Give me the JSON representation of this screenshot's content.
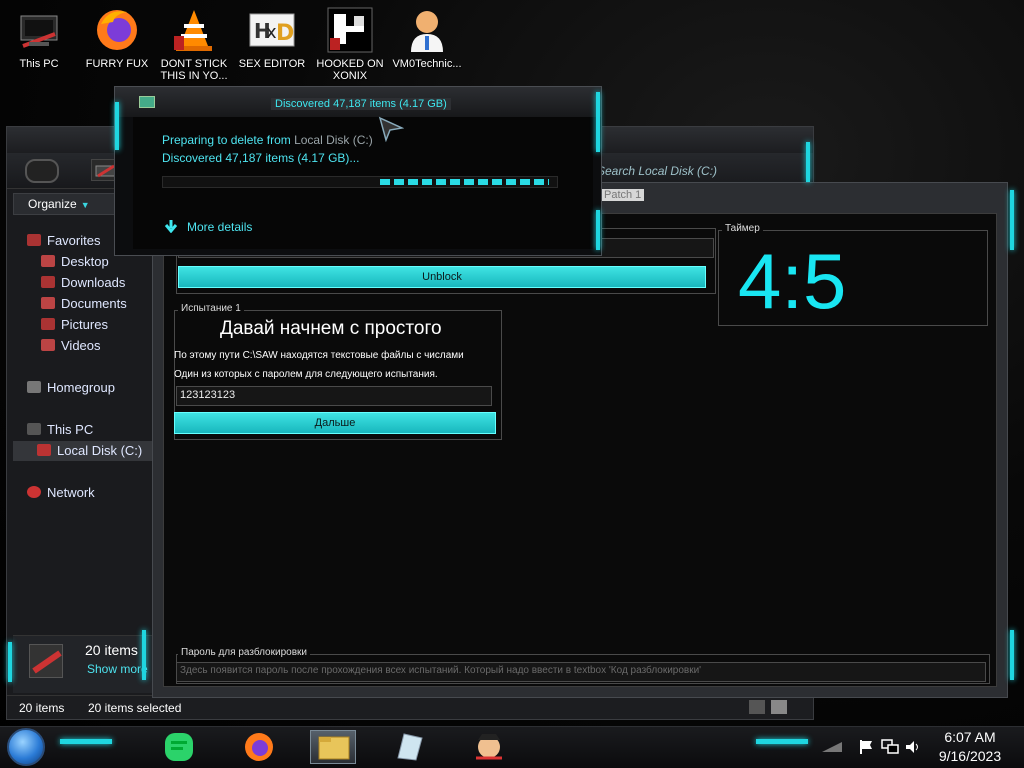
{
  "desktop": {
    "icons": [
      {
        "label": "This PC"
      },
      {
        "label": "FURRY FUX"
      },
      {
        "label": "DONT STICK THIS IN YO..."
      },
      {
        "label": "SEX EDITOR"
      },
      {
        "label": "HOOKED ON XONIX"
      },
      {
        "label": "VM0Technic..."
      }
    ]
  },
  "explorer": {
    "organize_label": "Organize",
    "search_placeholder": "Search Local Disk (C:)",
    "nav": {
      "favorites": "Favorites",
      "desktop": "Desktop",
      "downloads": "Downloads",
      "documents": "Documents",
      "pictures": "Pictures",
      "videos": "Videos",
      "homegroup": "Homegroup",
      "this_pc": "This PC",
      "local_disk": "Local Disk (C:)",
      "network": "Network"
    },
    "details_count": "20 items",
    "details_more": "Show more",
    "status_items": "20 items",
    "status_selected": "20 items selected"
  },
  "tool": {
    "tab_label": "Patch 1",
    "unblock_label": "Unblock",
    "timer_title": "Таймер",
    "timer_value": "4:5",
    "challenge_title": "Испытание 1",
    "challenge_heading": "Давай начнем с простого",
    "challenge_line1": "По этому пути C:\\SAW находятся текстовые файлы с числами",
    "challenge_line2": "Один из которых с паролем для следующего испытания.",
    "challenge_input": "123123123",
    "next_label": "Дальше",
    "password_title": "Пароль для разблокировки",
    "password_placeholder": "Здесь появится пароль после прохождения всех испытаний. Который надо ввести в textbox 'Код разблокировки'"
  },
  "dialog": {
    "title": "Discovered 47,187 items (4.17 GB)",
    "preparing_prefix": "Preparing to delete from ",
    "preparing_target": "Local Disk (C:)",
    "discovered": "Discovered 47,187 items (4.17 GB)...",
    "more_details": "More details",
    "progress": 0.55
  },
  "taskbar": {
    "time": "6:07 AM",
    "date": "9/16/2023"
  },
  "colors": {
    "accent": "#1fd6e0",
    "button_cyan": "#2ad0d6",
    "timer_cyan": "#19e6f2"
  },
  "icons": {
    "start": "start-orb-icon",
    "flag": "action-center-flag-icon",
    "network": "network-icon",
    "volume": "volume-icon"
  }
}
